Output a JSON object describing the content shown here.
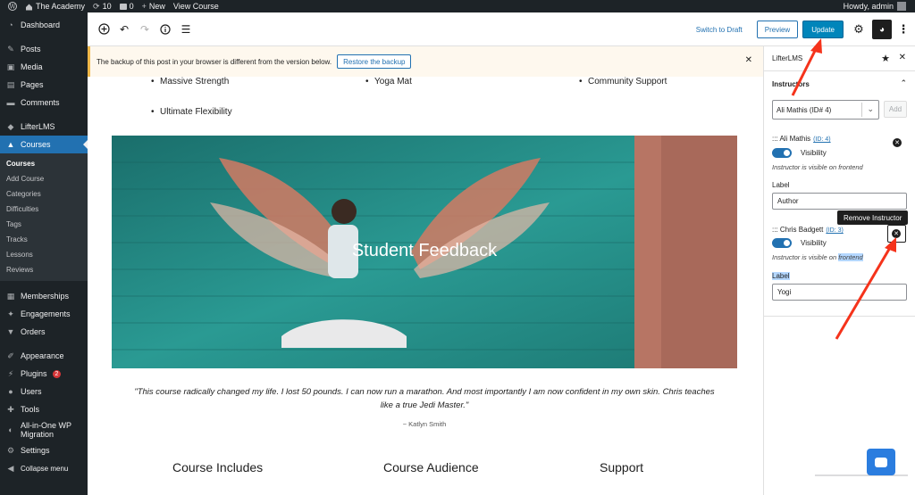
{
  "adminbar": {
    "site_name": "The Academy",
    "updates_count": "10",
    "comments_count": "0",
    "new_label": "New",
    "view_course": "View Course",
    "howdy": "Howdy, admin"
  },
  "sidebar": {
    "dashboard": "Dashboard",
    "posts": "Posts",
    "media": "Media",
    "pages": "Pages",
    "comments": "Comments",
    "lifterlms": "LifterLMS",
    "courses": "Courses",
    "submenu": [
      "Courses",
      "Add Course",
      "Categories",
      "Difficulties",
      "Tags",
      "Tracks",
      "Lessons",
      "Reviews"
    ],
    "memberships": "Memberships",
    "engagements": "Engagements",
    "orders": "Orders",
    "appearance": "Appearance",
    "plugins": "Plugins",
    "plugins_badge": "2",
    "users": "Users",
    "tools": "Tools",
    "migration_line1": "All-in-One WP",
    "migration_line2": "Migration",
    "settings": "Settings",
    "collapse": "Collapse menu"
  },
  "header": {
    "switch_to_draft": "Switch to Draft",
    "preview": "Preview",
    "update": "Update"
  },
  "notice": {
    "message": "The backup of this post in your browser is different from the version below.",
    "restore": "Restore the backup"
  },
  "content": {
    "list_items": [
      "Massive Strength",
      "Yoga Mat",
      "Community Support",
      "Ultimate Flexibility"
    ],
    "cover_title": "Student Feedback",
    "quote_line1": "\"This course radically changed my life. I lost 50 pounds. I can now run a marathon. And most importantly I am now confident in my own skin. Chris teaches",
    "quote_line2": "like a true Jedi Master.\"",
    "quote_author": "~ Katlyn Smith",
    "headings": [
      "Course Includes",
      "Course Audience",
      "Support"
    ]
  },
  "panel": {
    "title": "LifterLMS",
    "section": "Instructors",
    "select_value": "Ali Mathis (ID# 4)",
    "add": "Add",
    "instructors": [
      {
        "name": "::: Ali Mathis",
        "id": "(ID: 4)",
        "visibility": "Visibility",
        "help": "Instructor is visible on frontend",
        "label_title": "Label",
        "label_value": "Author"
      },
      {
        "name": "::: Chris Badgett",
        "id": "(ID: 3)",
        "visibility": "Visibility",
        "help_prefix": "Instructor is visible on ",
        "help_highlight": "frontend",
        "label_title": "Label",
        "label_value": "Yogi"
      }
    ],
    "tooltip": "Remove Instructor"
  },
  "colors": {
    "admin_dark": "#1d2327",
    "accent": "#2271b1",
    "update_button": "#0085ba",
    "annotation_arrow": "#f5331b",
    "cover_teal": "#1f8a86",
    "chat_blue": "#2b7ddf"
  }
}
